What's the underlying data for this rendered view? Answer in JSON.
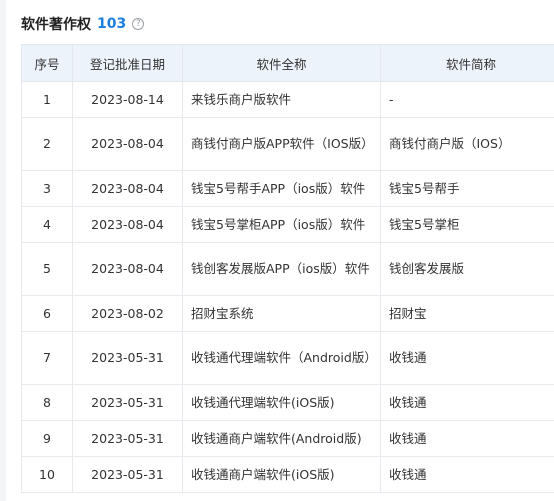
{
  "header": {
    "title": "软件著作权",
    "count": "103",
    "help_icon": "?"
  },
  "table": {
    "columns": [
      "序号",
      "登记批准日期",
      "软件全称",
      "软件简称"
    ],
    "rows": [
      {
        "idx": "1",
        "date": "2023-08-14",
        "name": "来钱乐商户版软件",
        "short": "-"
      },
      {
        "idx": "2",
        "date": "2023-08-04",
        "name": "商钱付商户版APP软件（IOS版）",
        "short": "商钱付商户版（IOS）"
      },
      {
        "idx": "3",
        "date": "2023-08-04",
        "name": "钱宝5号帮手APP（ios版）软件",
        "short": "钱宝5号帮手"
      },
      {
        "idx": "4",
        "date": "2023-08-04",
        "name": "钱宝5号掌柜APP（ios版）软件",
        "short": "钱宝5号掌柜"
      },
      {
        "idx": "5",
        "date": "2023-08-04",
        "name": "钱创客发展版APP（ios版）软件",
        "short": "钱创客发展版"
      },
      {
        "idx": "6",
        "date": "2023-08-02",
        "name": "招财宝系统",
        "short": "招财宝"
      },
      {
        "idx": "7",
        "date": "2023-05-31",
        "name": "收钱通代理端软件（Android版）",
        "short": "收钱通"
      },
      {
        "idx": "8",
        "date": "2023-05-31",
        "name": "收钱通代理端软件(iOS版)",
        "short": "收钱通"
      },
      {
        "idx": "9",
        "date": "2023-05-31",
        "name": "收钱通商户端软件(Android版)",
        "short": "收钱通"
      },
      {
        "idx": "10",
        "date": "2023-05-31",
        "name": "收钱通商户端软件(iOS版)",
        "short": "收钱通"
      }
    ]
  }
}
